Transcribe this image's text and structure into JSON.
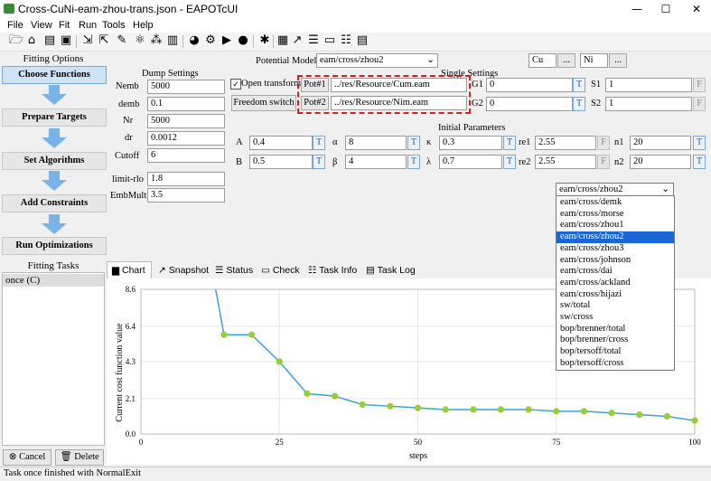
{
  "window": {
    "title": "Cross-CuNi-eam-zhou-trans.json - EAPOTcUI",
    "minimize": "—",
    "maximize": "☐",
    "close": "✕"
  },
  "menu": [
    "File",
    "View",
    "Fit",
    "Run",
    "Tools",
    "Help"
  ],
  "left": {
    "fitting_options": "Fitting Options",
    "steps": [
      "Choose Functions",
      "Prepare Targets",
      "Set Algorithms",
      "Add Constraints",
      "Run Optimizations"
    ],
    "fitting_tasks": "Fitting Tasks",
    "tasks": [
      "once (C)"
    ],
    "cancel": "Cancel",
    "delete": "Delete"
  },
  "potential": {
    "label": "Potential Model",
    "value": "eam/cross/zhou2",
    "elem1": "Cu",
    "elem2": "Ni",
    "browse": "..."
  },
  "dump": {
    "title": "Dump Settings",
    "rows": [
      {
        "label": "Nemb",
        "value": "5000"
      },
      {
        "label": "demb",
        "value": "0.1"
      },
      {
        "label": "Nr",
        "value": "5000"
      },
      {
        "label": "dr",
        "value": "0.0012"
      },
      {
        "label": "Cutoff",
        "value": "6"
      },
      {
        "label": "limit-rlo",
        "value": "1.8"
      },
      {
        "label": "EmbMult",
        "value": "3.5"
      }
    ]
  },
  "single": {
    "title": "Single Settings",
    "open_transform": "Open transform",
    "freedom_switch": "Freedom switch",
    "pot1": "Pot#1",
    "pot1_path": "../res/Resource/Cum.eam",
    "pot2": "Pot#2",
    "pot2_path": "../res/Resource/Nim.eam",
    "g1": "G1",
    "g1v": "0",
    "g2": "G2",
    "g2v": "0",
    "s1": "S1",
    "s1v": "1",
    "s2": "S2",
    "s2v": "1",
    "t": "T",
    "f": "F"
  },
  "initial": {
    "title": "Initial Parameters",
    "row1": [
      {
        "label": "A",
        "value": "0.4",
        "flag": "T"
      },
      {
        "label": "α",
        "value": "8",
        "flag": "T"
      },
      {
        "label": "κ",
        "value": "0.3",
        "flag": "T"
      },
      {
        "label": "re1",
        "value": "2.55",
        "flag": "F"
      },
      {
        "label": "n1",
        "value": "20",
        "flag": "T"
      }
    ],
    "row2": [
      {
        "label": "B",
        "value": "0.5",
        "flag": "T"
      },
      {
        "label": "β",
        "value": "4",
        "flag": "T"
      },
      {
        "label": "λ",
        "value": "0.7",
        "flag": "T"
      },
      {
        "label": "re2",
        "value": "2.55",
        "flag": "F"
      },
      {
        "label": "n2",
        "value": "20",
        "flag": "T"
      }
    ]
  },
  "dropdown": {
    "selected": "eam/cross/zhou2",
    "options": [
      "eam/cross/demk",
      "eam/cross/morse",
      "eam/cross/zhou1",
      "eam/cross/zhou2",
      "eam/cross/zhou3",
      "eam/cross/johnson",
      "eam/cross/dai",
      "eam/cross/ackland",
      "eam/cross/hijazi",
      "sw/total",
      "sw/cross",
      "bop/brenner/total",
      "bop/brenner/cross",
      "bop/tersoff/total",
      "bop/tersoff/cross"
    ],
    "highlight_index": 3
  },
  "tabs": [
    "Chart",
    "Snapshot",
    "Status",
    "Check",
    "Task Info",
    "Task Log"
  ],
  "chart_data": {
    "type": "line",
    "xlabel": "steps",
    "ylabel": "Current cost function value",
    "xlim": [
      0,
      100
    ],
    "ylim": [
      0,
      8.6
    ],
    "xticks": [
      "0",
      "25",
      "50",
      "75",
      "100"
    ],
    "yticks": [
      "0.0",
      "2.1",
      "4.3",
      "6.4",
      "8.6"
    ],
    "x": [
      15,
      20,
      25,
      30,
      35,
      40,
      45,
      50,
      55,
      60,
      65,
      70,
      75,
      80,
      85,
      90,
      95,
      100
    ],
    "y": [
      5.9,
      5.9,
      4.3,
      2.4,
      2.25,
      1.75,
      1.65,
      1.55,
      1.45,
      1.45,
      1.45,
      1.45,
      1.35,
      1.35,
      1.25,
      1.15,
      1.05,
      0.8
    ],
    "line_start": {
      "x": 13.5,
      "y": 8.6
    },
    "line_color": "#3aa3d8",
    "marker_color": "#9acd32",
    "grid": true
  },
  "status": "Task once finished with NormalExit"
}
